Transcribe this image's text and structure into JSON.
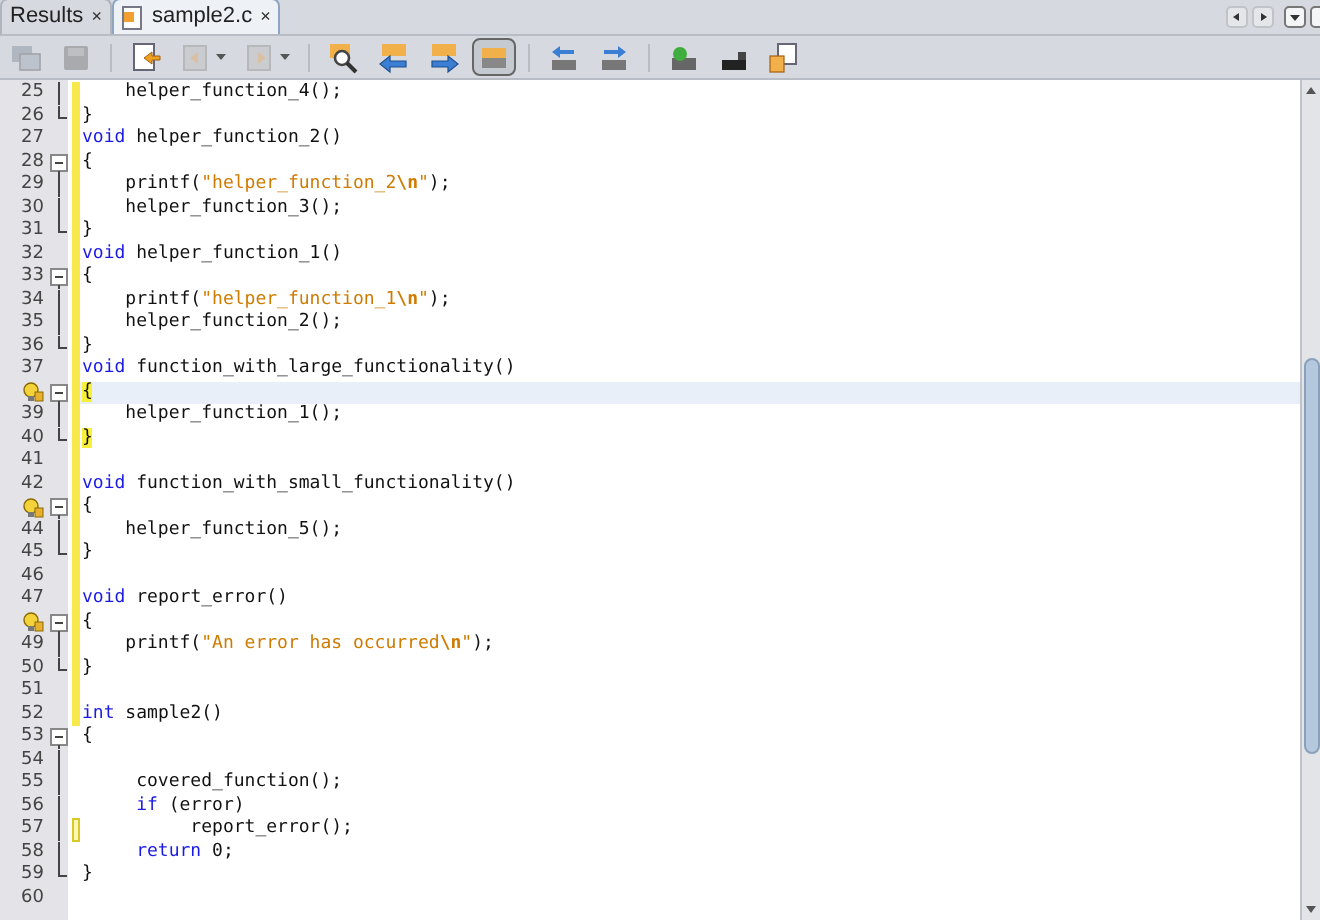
{
  "tabs": [
    {
      "label": "Results",
      "close": "×",
      "selected": false,
      "file_icon": false
    },
    {
      "label": "sample2.c",
      "close": "×",
      "selected": true,
      "file_icon": true
    }
  ],
  "toolbar": [
    {
      "kind": "windows",
      "disabled": true,
      "selected": false
    },
    {
      "kind": "save",
      "disabled": true,
      "selected": false
    },
    {
      "kind": "sep"
    },
    {
      "kind": "doc_back",
      "disabled": false,
      "selected": false
    },
    {
      "kind": "nav_back_menu",
      "disabled": true,
      "selected": false
    },
    {
      "kind": "nav_fwd_menu",
      "disabled": true,
      "selected": false
    },
    {
      "kind": "sep"
    },
    {
      "kind": "find",
      "disabled": false,
      "selected": false
    },
    {
      "kind": "prev",
      "disabled": false,
      "selected": false
    },
    {
      "kind": "next",
      "disabled": false,
      "selected": false
    },
    {
      "kind": "toggle",
      "disabled": false,
      "selected": true
    },
    {
      "kind": "sep"
    },
    {
      "kind": "shift_left",
      "disabled": false,
      "selected": false
    },
    {
      "kind": "shift_right",
      "disabled": false,
      "selected": false
    },
    {
      "kind": "sep"
    },
    {
      "kind": "macro",
      "disabled": false,
      "selected": false
    },
    {
      "kind": "stop",
      "disabled": false,
      "selected": false
    },
    {
      "kind": "doc_new",
      "disabled": false,
      "selected": false
    }
  ],
  "lines": [
    {
      "number": "25",
      "fold": {
        "kind": "line"
      },
      "coverage": {
        "kind": "full"
      },
      "hint": false,
      "current": false,
      "code": [
        {
          "kind": "plain",
          "t": "    helper_function_4();"
        }
      ]
    },
    {
      "number": "26",
      "fold": {
        "kind": "end"
      },
      "coverage": {
        "kind": "full"
      },
      "hint": false,
      "current": false,
      "code": [
        {
          "kind": "plain",
          "t": "}"
        }
      ]
    },
    {
      "number": "27",
      "coverage": {
        "kind": "full"
      },
      "hint": false,
      "current": false,
      "code": [
        {
          "kind": "keyword",
          "t": "void"
        },
        {
          "kind": "plain",
          "t": " helper_function_2()"
        }
      ]
    },
    {
      "number": "28",
      "fold": {
        "kind": "start"
      },
      "coverage": {
        "kind": "full"
      },
      "hint": false,
      "current": false,
      "code": [
        {
          "kind": "plain",
          "t": "{"
        }
      ]
    },
    {
      "number": "29",
      "fold": {
        "kind": "line"
      },
      "coverage": {
        "kind": "full"
      },
      "hint": false,
      "current": false,
      "code": [
        {
          "kind": "plain",
          "t": "    printf("
        },
        {
          "kind": "string",
          "t": "\"helper_function_2"
        },
        {
          "kind": "escape",
          "t": "\\n"
        },
        {
          "kind": "string",
          "t": "\""
        },
        {
          "kind": "plain",
          "t": ");"
        }
      ]
    },
    {
      "number": "30",
      "fold": {
        "kind": "line"
      },
      "coverage": {
        "kind": "full"
      },
      "hint": false,
      "current": false,
      "code": [
        {
          "kind": "plain",
          "t": "    helper_function_3();"
        }
      ]
    },
    {
      "number": "31",
      "fold": {
        "kind": "end"
      },
      "coverage": {
        "kind": "full"
      },
      "hint": false,
      "current": false,
      "code": [
        {
          "kind": "plain",
          "t": "}"
        }
      ]
    },
    {
      "number": "32",
      "coverage": {
        "kind": "full"
      },
      "hint": false,
      "current": false,
      "code": [
        {
          "kind": "keyword",
          "t": "void"
        },
        {
          "kind": "plain",
          "t": " helper_function_1()"
        }
      ]
    },
    {
      "number": "33",
      "fold": {
        "kind": "start"
      },
      "coverage": {
        "kind": "full"
      },
      "hint": false,
      "current": false,
      "code": [
        {
          "kind": "plain",
          "t": "{"
        }
      ]
    },
    {
      "number": "34",
      "fold": {
        "kind": "line"
      },
      "coverage": {
        "kind": "full"
      },
      "hint": false,
      "current": false,
      "code": [
        {
          "kind": "plain",
          "t": "    printf("
        },
        {
          "kind": "string",
          "t": "\"helper_function_1"
        },
        {
          "kind": "escape",
          "t": "\\n"
        },
        {
          "kind": "string",
          "t": "\""
        },
        {
          "kind": "plain",
          "t": ");"
        }
      ]
    },
    {
      "number": "35",
      "fold": {
        "kind": "line"
      },
      "coverage": {
        "kind": "full"
      },
      "hint": false,
      "current": false,
      "code": [
        {
          "kind": "plain",
          "t": "    helper_function_2();"
        }
      ]
    },
    {
      "number": "36",
      "fold": {
        "kind": "end"
      },
      "coverage": {
        "kind": "full"
      },
      "hint": false,
      "current": false,
      "code": [
        {
          "kind": "plain",
          "t": "}"
        }
      ]
    },
    {
      "number": "37",
      "coverage": {
        "kind": "full"
      },
      "hint": false,
      "current": false,
      "code": [
        {
          "kind": "keyword",
          "t": "void"
        },
        {
          "kind": "plain",
          "t": " function_with_large_functionality()"
        }
      ]
    },
    {
      "fold": {
        "kind": "start"
      },
      "coverage": {
        "kind": "full"
      },
      "hint": true,
      "current": true,
      "code": [
        {
          "kind": "match",
          "t": "{"
        }
      ]
    },
    {
      "number": "39",
      "fold": {
        "kind": "line"
      },
      "coverage": {
        "kind": "full"
      },
      "hint": false,
      "current": false,
      "code": [
        {
          "kind": "plain",
          "t": "    helper_function_1();"
        }
      ]
    },
    {
      "number": "40",
      "fold": {
        "kind": "end"
      },
      "coverage": {
        "kind": "full"
      },
      "hint": false,
      "current": false,
      "code": [
        {
          "kind": "match",
          "t": "}"
        }
      ]
    },
    {
      "number": "41",
      "coverage": {
        "kind": "full"
      },
      "hint": false,
      "current": false
    },
    {
      "number": "42",
      "coverage": {
        "kind": "full"
      },
      "hint": false,
      "current": false,
      "code": [
        {
          "kind": "keyword",
          "t": "void"
        },
        {
          "kind": "plain",
          "t": " function_with_small_functionality()"
        }
      ]
    },
    {
      "fold": {
        "kind": "start"
      },
      "coverage": {
        "kind": "full"
      },
      "hint": true,
      "current": false,
      "code": [
        {
          "kind": "plain",
          "t": "{"
        }
      ]
    },
    {
      "number": "44",
      "fold": {
        "kind": "line"
      },
      "coverage": {
        "kind": "full"
      },
      "hint": false,
      "current": false,
      "code": [
        {
          "kind": "plain",
          "t": "    helper_function_5();"
        }
      ]
    },
    {
      "number": "45",
      "fold": {
        "kind": "end"
      },
      "coverage": {
        "kind": "full"
      },
      "hint": false,
      "current": false,
      "code": [
        {
          "kind": "plain",
          "t": "}"
        }
      ]
    },
    {
      "number": "46",
      "coverage": {
        "kind": "full"
      },
      "hint": false,
      "current": false
    },
    {
      "number": "47",
      "coverage": {
        "kind": "full"
      },
      "hint": false,
      "current": false,
      "code": [
        {
          "kind": "keyword",
          "t": "void"
        },
        {
          "kind": "plain",
          "t": " report_error()"
        }
      ]
    },
    {
      "fold": {
        "kind": "start"
      },
      "coverage": {
        "kind": "full"
      },
      "hint": true,
      "current": false,
      "code": [
        {
          "kind": "plain",
          "t": "{"
        }
      ]
    },
    {
      "number": "49",
      "fold": {
        "kind": "line"
      },
      "coverage": {
        "kind": "full"
      },
      "hint": false,
      "current": false,
      "code": [
        {
          "kind": "plain",
          "t": "    printf("
        },
        {
          "kind": "string",
          "t": "\"An error has occurred"
        },
        {
          "kind": "escape",
          "t": "\\n"
        },
        {
          "kind": "string",
          "t": "\""
        },
        {
          "kind": "plain",
          "t": ");"
        }
      ]
    },
    {
      "number": "50",
      "fold": {
        "kind": "end"
      },
      "coverage": {
        "kind": "full"
      },
      "hint": false,
      "current": false,
      "code": [
        {
          "kind": "plain",
          "t": "}"
        }
      ]
    },
    {
      "number": "51",
      "coverage": {
        "kind": "full"
      },
      "hint": false,
      "current": false
    },
    {
      "number": "52",
      "coverage": {
        "kind": "full"
      },
      "hint": false,
      "current": false,
      "code": [
        {
          "kind": "keyword",
          "t": "int"
        },
        {
          "kind": "plain",
          "t": " sample2()"
        }
      ]
    },
    {
      "number": "53",
      "fold": {
        "kind": "start"
      },
      "hint": false,
      "current": false,
      "code": [
        {
          "kind": "plain",
          "t": "{"
        }
      ]
    },
    {
      "number": "54",
      "fold": {
        "kind": "line"
      },
      "hint": false,
      "current": false
    },
    {
      "number": "55",
      "fold": {
        "kind": "line"
      },
      "hint": false,
      "current": false,
      "code": [
        {
          "kind": "plain",
          "t": "     covered_function();"
        }
      ]
    },
    {
      "number": "56",
      "fold": {
        "kind": "line"
      },
      "hint": false,
      "current": false,
      "code": [
        {
          "kind": "keyword",
          "t": "     if"
        },
        {
          "kind": "plain",
          "t": " (error)"
        }
      ]
    },
    {
      "number": "57",
      "fold": {
        "kind": "line"
      },
      "coverage": {
        "kind": "partial"
      },
      "hint": false,
      "current": false,
      "code": [
        {
          "kind": "plain",
          "t": "          report_error();"
        }
      ]
    },
    {
      "number": "58",
      "fold": {
        "kind": "line"
      },
      "hint": false,
      "current": false,
      "code": [
        {
          "kind": "keyword",
          "t": "     return"
        },
        {
          "kind": "plain",
          "t": " 0;"
        }
      ]
    },
    {
      "number": "59",
      "fold": {
        "kind": "end"
      },
      "hint": false,
      "current": false,
      "code": [
        {
          "kind": "plain",
          "t": "}"
        }
      ]
    },
    {
      "number": "60",
      "hint": false,
      "current": false
    }
  ]
}
